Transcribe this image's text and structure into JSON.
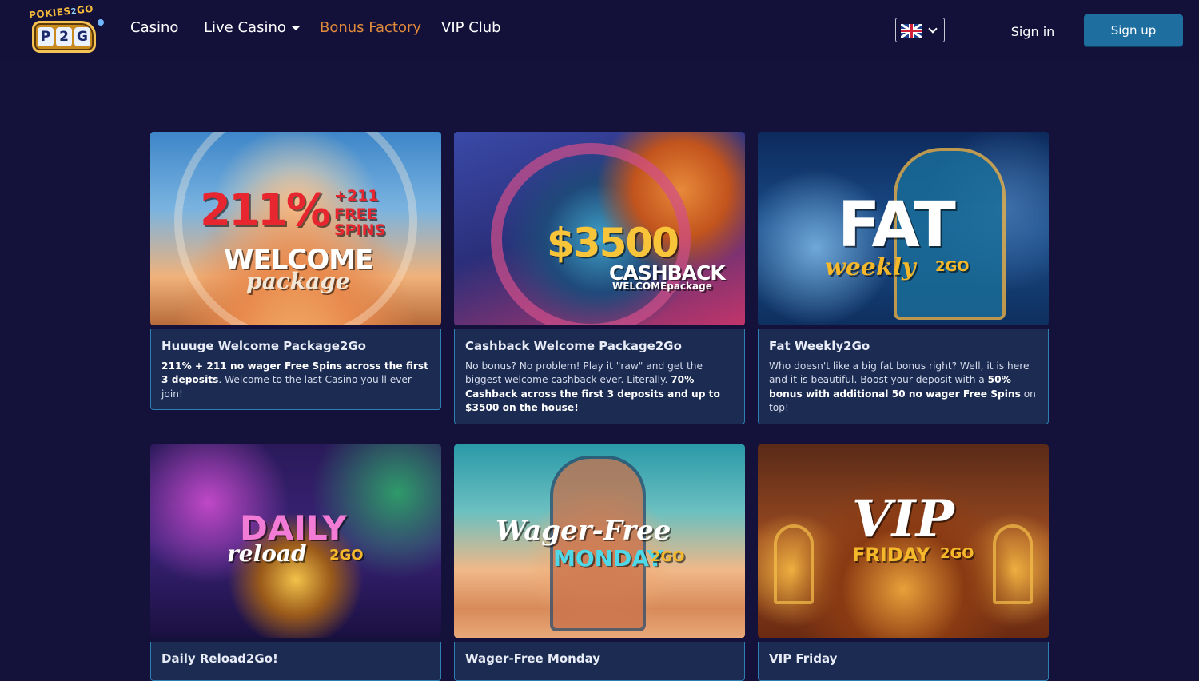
{
  "header": {
    "logo": {
      "top": "POKIES",
      "sup": "2",
      "go": "GO",
      "letters": [
        "P",
        "2",
        "G"
      ]
    },
    "nav": [
      {
        "label": "Casino"
      },
      {
        "label": "Live Casino"
      },
      {
        "label": "Bonus Factory",
        "active": true
      },
      {
        "label": "VIP Club"
      }
    ],
    "language": "English (UK)",
    "signin_label": "Sign in",
    "signup_label": "Sign up"
  },
  "colors": {
    "background": "#14123a",
    "active_nav": "#e08a3a",
    "signup_button": "#1f6ea0",
    "card_border": "#2d7fb3",
    "card_body": "#1c2b52"
  },
  "cards": [
    {
      "image": {
        "line1": "211%",
        "line2": "+211",
        "line3": "FREE",
        "line4": "SPINS",
        "line5": "WELCOME",
        "line6": "package"
      },
      "title": "Huuuge Welcome Package2Go",
      "desc": [
        {
          "b": "211% + 211 no wager Free Spins across the first 3 deposits"
        },
        {
          "t": ". Welcome to the last Casino you'll ever join!"
        }
      ]
    },
    {
      "image": {
        "line1": "$3500",
        "line2": "CASHBACK",
        "line3": "WELCOMEpackage"
      },
      "title": "Cashback Welcome Package2Go",
      "desc": [
        {
          "t": "No bonus? No problem! Play it \"raw\" and get the biggest welcome cashback ever. Literally. "
        },
        {
          "b": "70% Cashback across the first 3 deposits and up to $3500 on the house!"
        }
      ]
    },
    {
      "image": {
        "line1": "FAT",
        "line2": "weekly",
        "line3": "2GO"
      },
      "title": "Fat Weekly2Go",
      "desc": [
        {
          "t": "Who doesn't like a big fat bonus right? Well, it is here and it is beautiful. Boost your deposit with a "
        },
        {
          "b": "50% bonus with additional 50 no wager Free Spins"
        },
        {
          "t": " on top!"
        }
      ]
    },
    {
      "image": {
        "line1": "DAILY",
        "line2": "reload",
        "line3": "2GO"
      },
      "title": "Daily Reload2Go!"
    },
    {
      "image": {
        "line1": "Wager-Free",
        "line2": "MONDAY",
        "line3": "2GO"
      },
      "title": "Wager-Free Monday"
    },
    {
      "image": {
        "line1": "VIP",
        "line2": "FRIDAY",
        "line3": "2GO"
      },
      "title": "VIP Friday"
    }
  ]
}
